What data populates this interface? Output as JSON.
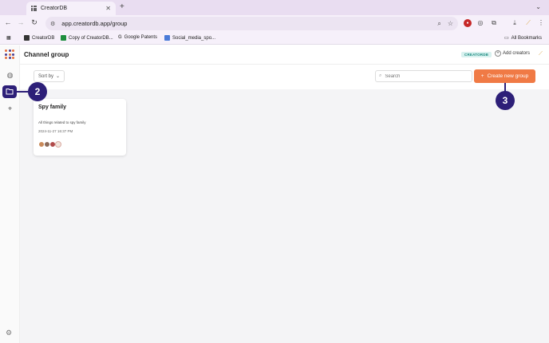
{
  "browser": {
    "tab_title": "CreatorDB",
    "url": "app.creatordb.app/group",
    "bookmarks": [
      "CreatorDB",
      "Copy of CreatorDB...",
      "Google Patents",
      "Social_media_spo..."
    ],
    "all_bookmarks": "All Bookmarks"
  },
  "header": {
    "title": "Channel group",
    "badge": "CREATORDB",
    "add_creators": "Add creators"
  },
  "controls": {
    "sort_label": "Sort by",
    "search_placeholder": "Search",
    "create_label": "Create new group"
  },
  "groups": [
    {
      "name": "Spy family",
      "description": "All things related to spy family",
      "date": "2024-11-27 16:37 PM"
    }
  ],
  "callouts": [
    "2",
    "3"
  ],
  "colors": {
    "accent": "#f07a45",
    "primary": "#2d1f78",
    "badge_text": "#1a8a7f"
  }
}
